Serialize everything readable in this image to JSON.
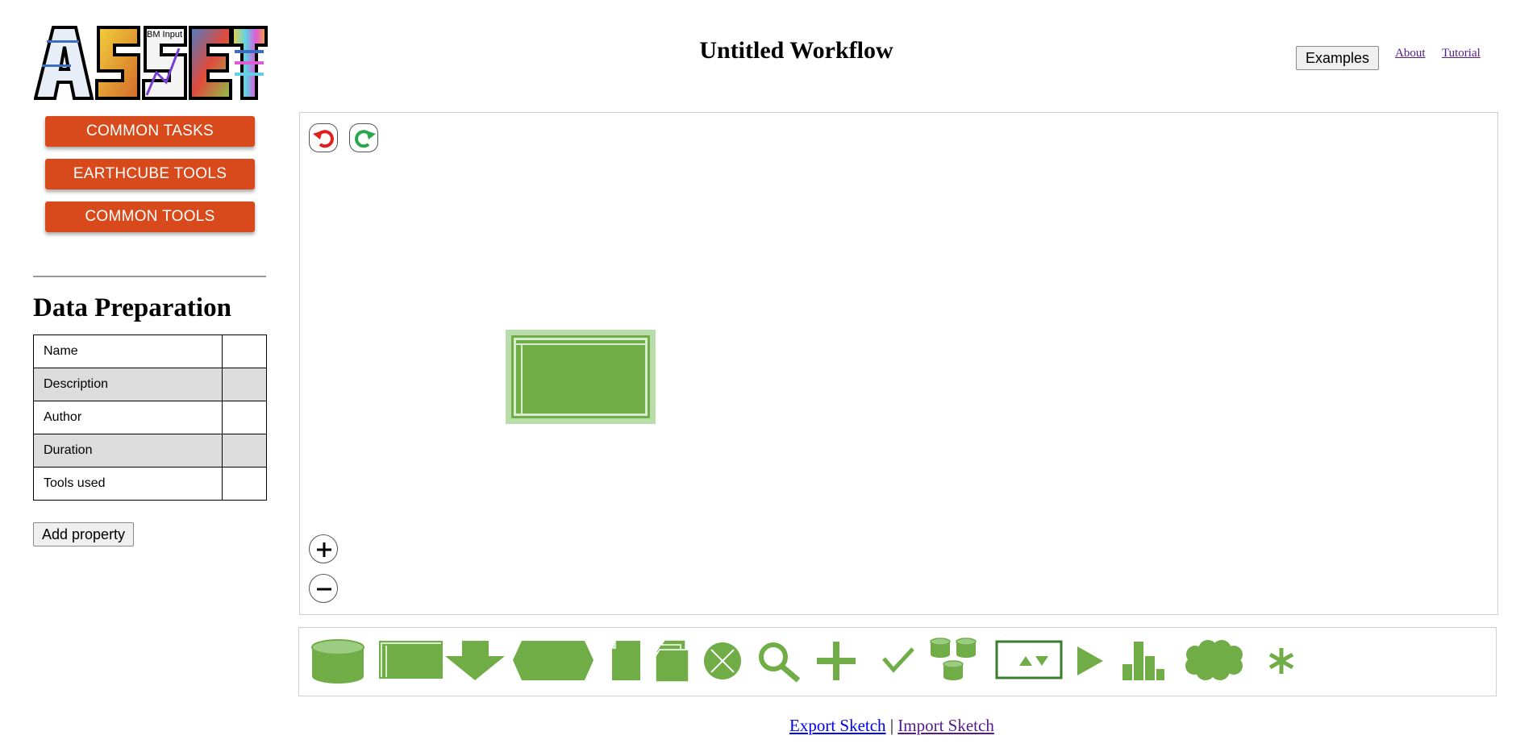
{
  "logo": {
    "text": "ASSET",
    "inset_text": "BM Input"
  },
  "sidebar": {
    "buttons": [
      "COMMON TASKS",
      "EARTHCUBE TOOLS",
      "COMMON TOOLS"
    ],
    "panel_title": "Data Preparation",
    "properties": [
      {
        "label": "Name",
        "value": ""
      },
      {
        "label": "Description",
        "value": ""
      },
      {
        "label": "Author",
        "value": ""
      },
      {
        "label": "Duration",
        "value": ""
      },
      {
        "label": "Tools used",
        "value": ""
      }
    ],
    "add_property_label": "Add property"
  },
  "header": {
    "title": "Untitled Workflow",
    "examples_label": "Examples",
    "about_label": "About",
    "tutorial_label": "Tutorial"
  },
  "canvas": {
    "controls": [
      "undo-icon",
      "redo-icon",
      "zoom-in-icon",
      "zoom-out-icon"
    ],
    "nodes": [
      {
        "shape": "process-rectangle",
        "selected": true
      }
    ]
  },
  "palette": {
    "shapes": [
      "cylinder-icon",
      "rectangle-icon",
      "down-arrow-icon",
      "hexagon-icon",
      "document-icon",
      "multi-document-icon",
      "circle-x-icon",
      "magnifier-icon",
      "plus-icon",
      "checkmark-icon",
      "databases-icon",
      "sort-box-icon",
      "play-icon",
      "bar-chart-icon",
      "cloud-icon",
      "asterisk-icon"
    ]
  },
  "footer": {
    "export_label": "Export Sketch",
    "separator": "|",
    "import_label": "Import Sketch"
  },
  "colors": {
    "accent_orange": "#d84a1b",
    "shape_green": "#71ad47",
    "node_highlight": "#b9deac",
    "undo_red": "#e0201c",
    "redo_green": "#2aa64a"
  }
}
